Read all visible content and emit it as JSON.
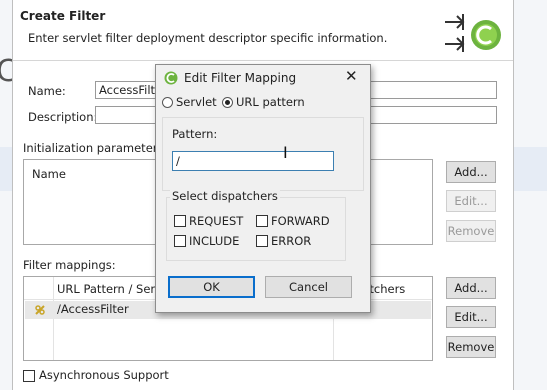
{
  "wizard": {
    "title": "Create Filter",
    "description": "Enter servlet filter deployment descriptor specific information.",
    "name_label": "Name:",
    "name_value": "AccessFilter",
    "description_label": "Description:",
    "description_value": "",
    "init_params_label": "Initialization parameters:",
    "init_params_header": "Name",
    "init_buttons": {
      "add": "Add...",
      "edit": "Edit...",
      "remove": "Remove"
    },
    "filter_mappings_label": "Filter mappings:",
    "mappings_headers": [
      "URL Pattern / Servlet Name",
      "Dispatchers"
    ],
    "mappings_rows": [
      {
        "pattern": "/AccessFilter",
        "dispatchers": ""
      }
    ],
    "mapping_buttons": {
      "add": "Add...",
      "edit": "Edit...",
      "remove": "Remove"
    },
    "async_label": "Asynchronous Support",
    "async_checked": false
  },
  "dialog": {
    "title": "Edit Filter Mapping",
    "close_symbol": "✕",
    "radio_servlet": "Servlet",
    "radio_url": "URL pattern",
    "selected": "URL pattern",
    "pattern_label": "Pattern:",
    "pattern_value": "/",
    "dispatchers_label": "Select dispatchers",
    "dispatchers": {
      "request": "REQUEST",
      "forward": "FORWARD",
      "include": "INCLUDE",
      "error": "ERROR"
    },
    "ok": "OK",
    "cancel": "Cancel"
  },
  "background": {
    "partial_letter": "C"
  }
}
